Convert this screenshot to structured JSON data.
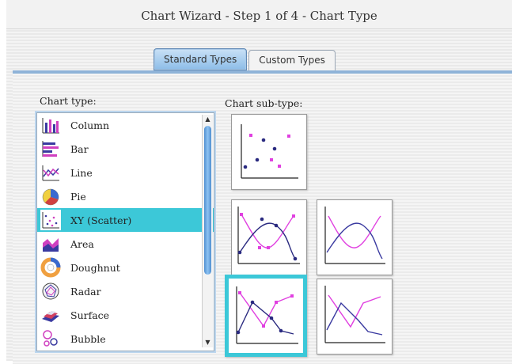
{
  "window": {
    "title": "Chart Wizard - Step 1 of 4 - Chart Type"
  },
  "tabs": [
    {
      "label": "Standard Types",
      "active": true
    },
    {
      "label": "Custom Types",
      "active": false
    }
  ],
  "chart_type": {
    "label": "Chart type:",
    "items": [
      {
        "label": "Column",
        "icon": "column-chart-icon"
      },
      {
        "label": "Bar",
        "icon": "bar-chart-icon"
      },
      {
        "label": "Line",
        "icon": "line-chart-icon"
      },
      {
        "label": "Pie",
        "icon": "pie-chart-icon"
      },
      {
        "label": "XY (Scatter)",
        "icon": "scatter-chart-icon",
        "selected": true
      },
      {
        "label": "Area",
        "icon": "area-chart-icon"
      },
      {
        "label": "Doughnut",
        "icon": "doughnut-chart-icon"
      },
      {
        "label": "Radar",
        "icon": "radar-chart-icon"
      },
      {
        "label": "Surface",
        "icon": "surface-chart-icon"
      },
      {
        "label": "Bubble",
        "icon": "bubble-chart-icon"
      }
    ]
  },
  "sub_type": {
    "label": "Chart sub-type:",
    "options": [
      {
        "name": "scatter-markers-only"
      },
      {
        "name": "scatter-smoothed-lines-markers"
      },
      {
        "name": "scatter-smoothed-lines"
      },
      {
        "name": "scatter-straight-lines-markers",
        "selected": true
      },
      {
        "name": "scatter-straight-lines"
      }
    ]
  },
  "colors": {
    "selection": "#3cc8d8",
    "series1": "#e040e0",
    "series2": "#2a2a80"
  }
}
